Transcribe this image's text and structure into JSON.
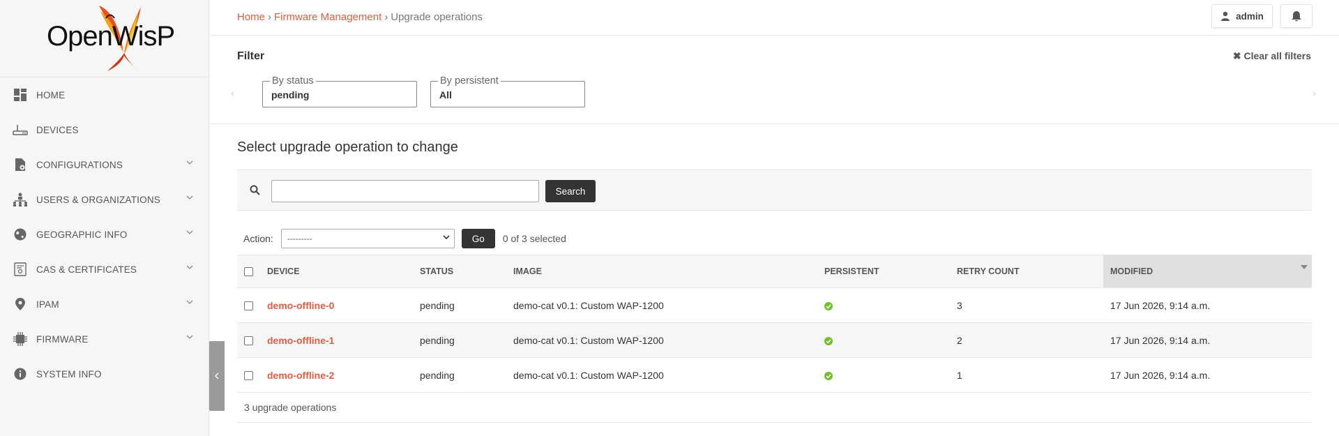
{
  "logo": {
    "text": "OpenWisP"
  },
  "sidebar": {
    "items": [
      {
        "label": "HOME",
        "icon": "dashboard-icon",
        "expandable": false
      },
      {
        "label": "DEVICES",
        "icon": "router-icon",
        "expandable": false
      },
      {
        "label": "CONFIGURATIONS",
        "icon": "config-file-icon",
        "expandable": true
      },
      {
        "label": "USERS & ORGANIZATIONS",
        "icon": "org-tree-icon",
        "expandable": true
      },
      {
        "label": "GEOGRAPHIC INFO",
        "icon": "globe-icon",
        "expandable": true
      },
      {
        "label": "CAS & CERTIFICATES",
        "icon": "certificate-icon",
        "expandable": true
      },
      {
        "label": "IPAM",
        "icon": "map-pin-icon",
        "expandable": true
      },
      {
        "label": "FIRMWARE",
        "icon": "chip-icon",
        "expandable": true
      },
      {
        "label": "SYSTEM INFO",
        "icon": "info-icon",
        "expandable": false
      }
    ]
  },
  "header": {
    "breadcrumb": {
      "home": "Home",
      "section": "Firmware Management",
      "current": "Upgrade operations",
      "sep": "›"
    },
    "user": "admin"
  },
  "filter": {
    "title": "Filter",
    "clear_label": "✖ Clear all filters",
    "status": {
      "legend": "By status",
      "value": "pending"
    },
    "persistent": {
      "legend": "By persistent",
      "value": "All"
    }
  },
  "page_title": "Select upgrade operation to change",
  "search": {
    "button": "Search",
    "value": ""
  },
  "actions": {
    "label": "Action:",
    "selected_option": "---------",
    "go": "Go",
    "selected_count": "0 of 3 selected"
  },
  "table": {
    "columns": [
      "DEVICE",
      "STATUS",
      "IMAGE",
      "PERSISTENT",
      "RETRY COUNT",
      "MODIFIED"
    ],
    "rows": [
      {
        "device": "demo-offline-0",
        "status": "pending",
        "image": "demo-cat v0.1: Custom WAP-1200",
        "persistent": true,
        "retry": "3",
        "modified": "17 Jun 2026, 9:14 a.m."
      },
      {
        "device": "demo-offline-1",
        "status": "pending",
        "image": "demo-cat v0.1: Custom WAP-1200",
        "persistent": true,
        "retry": "2",
        "modified": "17 Jun 2026, 9:14 a.m."
      },
      {
        "device": "demo-offline-2",
        "status": "pending",
        "image": "demo-cat v0.1: Custom WAP-1200",
        "persistent": true,
        "retry": "1",
        "modified": "17 Jun 2026, 9:14 a.m."
      }
    ]
  },
  "result_count": "3 upgrade operations",
  "colors": {
    "accent": "#df5d43",
    "dark_button": "#333333",
    "check_green": "#70bf2b"
  }
}
